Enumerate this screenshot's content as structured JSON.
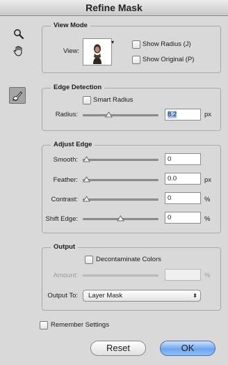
{
  "window": {
    "title": "Refine Mask"
  },
  "tools": {
    "zoom": "zoom-icon",
    "hand": "hand-icon",
    "refine_radius": "refine-radius-brush-icon"
  },
  "view_mode": {
    "title": "View Mode",
    "view_label": "View:",
    "show_radius": {
      "label": "Show Radius (J)",
      "checked": false
    },
    "show_original": {
      "label": "Show Original (P)",
      "checked": false
    }
  },
  "edge_detection": {
    "title": "Edge Detection",
    "smart_radius": {
      "label": "Smart Radius",
      "checked": false
    },
    "radius": {
      "label": "Radius:",
      "value": "8.2",
      "unit": "px",
      "slider_fraction": 0.33
    }
  },
  "adjust_edge": {
    "title": "Adjust Edge",
    "rows": [
      {
        "label": "Smooth:",
        "value": "0",
        "unit": "",
        "slider_fraction": 0.0
      },
      {
        "label": "Feather:",
        "value": "0.0",
        "unit": "px",
        "slider_fraction": 0.0
      },
      {
        "label": "Contrast:",
        "value": "0",
        "unit": "%",
        "slider_fraction": 0.0
      },
      {
        "label": "Shift Edge:",
        "value": "0",
        "unit": "%",
        "slider_fraction": 0.5
      }
    ]
  },
  "output": {
    "title": "Output",
    "decontaminate": {
      "label": "Decontaminate Colors",
      "checked": false
    },
    "amount": {
      "label": "Amount:",
      "value": "",
      "unit": "%",
      "disabled": true
    },
    "output_to": {
      "label": "Output To:",
      "selected": "Layer Mask"
    }
  },
  "remember": {
    "label": "Remember Settings",
    "checked": false
  },
  "buttons": {
    "reset": "Reset",
    "ok": "OK"
  },
  "colors": {
    "accent": "#6fa6ee",
    "panel": "#d9d9d9"
  }
}
